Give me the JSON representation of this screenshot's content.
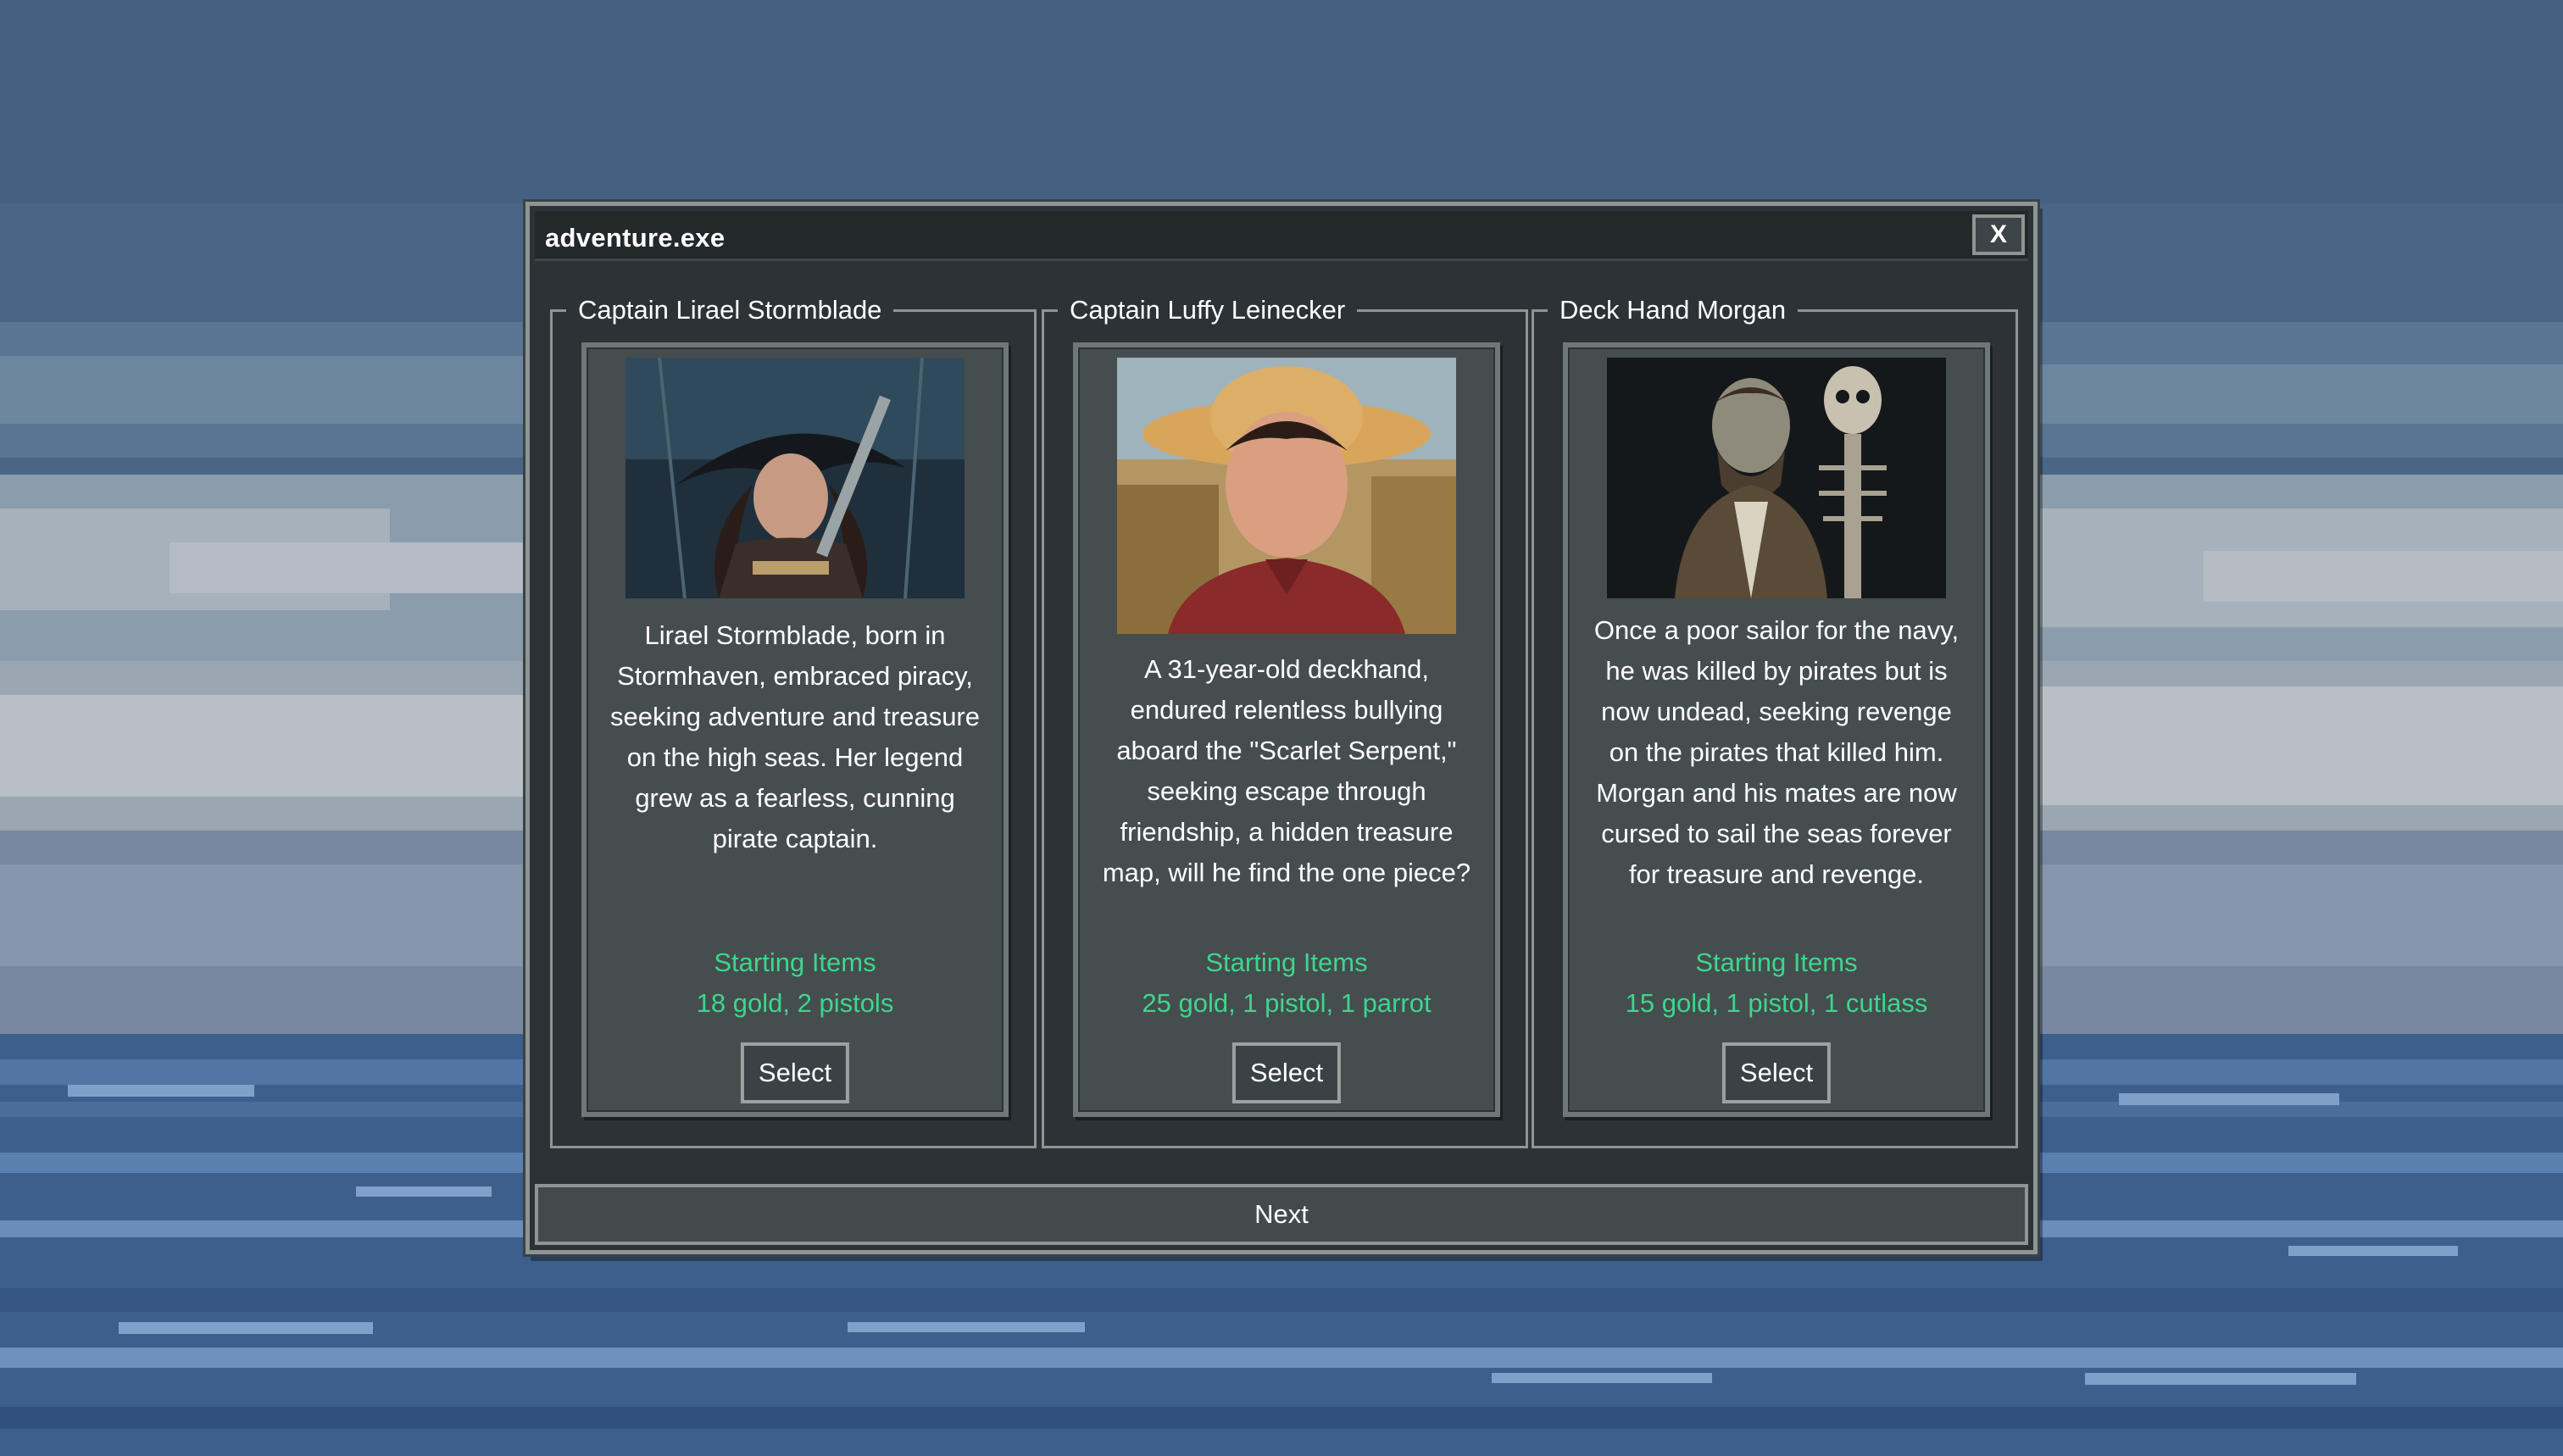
{
  "window": {
    "title": "adventure.exe",
    "close_label": "X",
    "next_label": "Next"
  },
  "characters": [
    {
      "name": "Captain Lirael Stormblade",
      "portrait_icon": "pirate-captain-woman-portrait",
      "description": "Lirael Stormblade, born in Stormhaven, embraced piracy, seeking adventure and treasure on the high seas. Her legend grew as a fearless, cunning pirate captain.",
      "items_heading": "Starting Items",
      "items": "18 gold, 2 pistols",
      "select_label": "Select"
    },
    {
      "name": "Captain Luffy Leinecker",
      "portrait_icon": "straw-hat-man-portrait",
      "description": "A 31-year-old deckhand, endured relentless bullying aboard the \"Scarlet Serpent,\" seeking escape through friendship, a hidden treasure map, will he find the one piece?",
      "items_heading": "Starting Items",
      "items": "25 gold, 1 pistol, 1 parrot",
      "select_label": "Select"
    },
    {
      "name": "Deck Hand Morgan",
      "portrait_icon": "undead-sailor-skeleton-portrait",
      "description": "Once a poor sailor for the navy, he was killed by pirates but is now undead, seeking revenge on the pirates that killed him. Morgan and his mates are now cursed to sail the seas forever for treasure and revenge.",
      "items_heading": "Starting Items",
      "items": "15 gold, 1 pistol, 1 cutlass",
      "select_label": "Select"
    }
  ],
  "colors": {
    "accent_green": "#3dd68c",
    "window_bg": "#2c3236",
    "card_bg": "#454d4f",
    "border": "#8d9694",
    "sky": "#4a6585",
    "sea": "#3d5f8c"
  }
}
